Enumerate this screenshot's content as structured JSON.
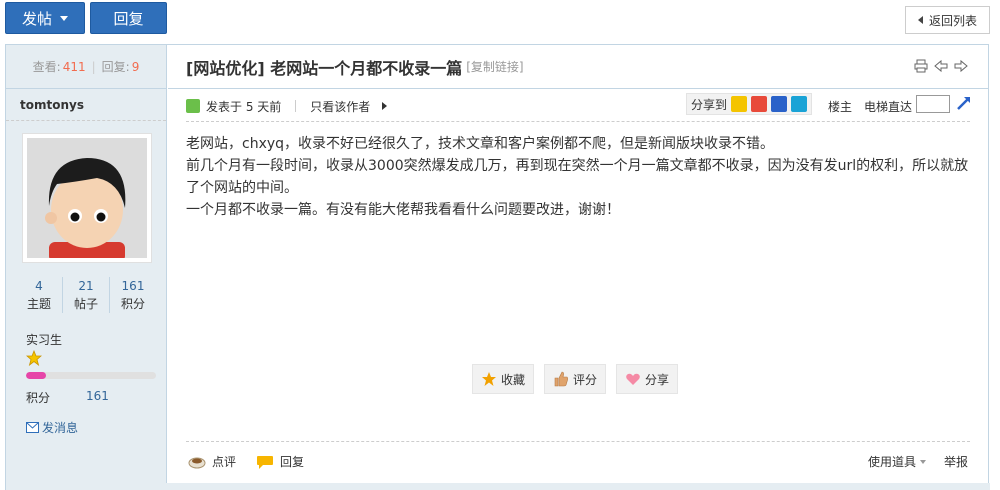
{
  "toolbar": {
    "post_label": "发帖",
    "reply_label": "回复",
    "back_label": "返回列表"
  },
  "sidebar": {
    "views_label": "查看:",
    "views": "411",
    "replies_label": "回复:",
    "replies": "9",
    "author": "tomtonys",
    "stats": [
      {
        "value": "4",
        "label": "主题"
      },
      {
        "value": "21",
        "label": "帖子"
      },
      {
        "value": "161",
        "label": "积分"
      }
    ],
    "rank": "实习生",
    "score_label": "积分",
    "score": "161",
    "message_label": "发消息"
  },
  "thread": {
    "title": "[网站优化] 老网站一个月都不收录一篇",
    "copy_link": "[复制链接]",
    "posted": "发表于 5 天前",
    "only_author": "只看该作者",
    "share_label": "分享到",
    "louzhu": "楼主",
    "elevator": "电梯直达",
    "paragraphs": [
      "老网站，chxyq，收录不好已经很久了，技术文章和客户案例都不爬，但是新闻版块收录不错。",
      "前几个月有一段时间，收录从3000突然爆发成几万，再到现在突然一个月一篇文章都不收录，因为没有发url的权利，所以就放了个网站的中间。",
      "一个月都不收录一篇。有没有能大佬帮我看看什么问题要改进，谢谢！"
    ]
  },
  "actions": {
    "favorite": "收藏",
    "rate": "评分",
    "share": "分享"
  },
  "bottom": {
    "comment": "点评",
    "reply": "回复",
    "tools": "使用道具",
    "report": "举报"
  },
  "colors": {
    "accent": "#2f6fba",
    "sidebar_bg": "#e5edf2",
    "border": "#c2d5e3",
    "highlight_num": "#f26c4f",
    "link": "#336699"
  },
  "progress": {
    "rank_progress": 0.15
  }
}
